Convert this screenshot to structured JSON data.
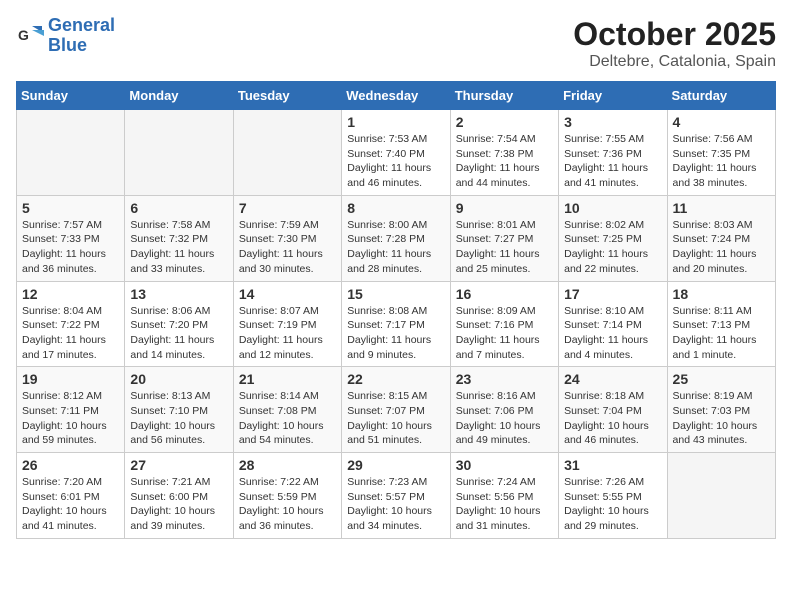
{
  "logo": {
    "line1": "General",
    "line2": "Blue"
  },
  "title": "October 2025",
  "location": "Deltebre, Catalonia, Spain",
  "days_of_week": [
    "Sunday",
    "Monday",
    "Tuesday",
    "Wednesday",
    "Thursday",
    "Friday",
    "Saturday"
  ],
  "weeks": [
    [
      {
        "day": "",
        "info": ""
      },
      {
        "day": "",
        "info": ""
      },
      {
        "day": "",
        "info": ""
      },
      {
        "day": "1",
        "info": "Sunrise: 7:53 AM\nSunset: 7:40 PM\nDaylight: 11 hours and 46 minutes."
      },
      {
        "day": "2",
        "info": "Sunrise: 7:54 AM\nSunset: 7:38 PM\nDaylight: 11 hours and 44 minutes."
      },
      {
        "day": "3",
        "info": "Sunrise: 7:55 AM\nSunset: 7:36 PM\nDaylight: 11 hours and 41 minutes."
      },
      {
        "day": "4",
        "info": "Sunrise: 7:56 AM\nSunset: 7:35 PM\nDaylight: 11 hours and 38 minutes."
      }
    ],
    [
      {
        "day": "5",
        "info": "Sunrise: 7:57 AM\nSunset: 7:33 PM\nDaylight: 11 hours and 36 minutes."
      },
      {
        "day": "6",
        "info": "Sunrise: 7:58 AM\nSunset: 7:32 PM\nDaylight: 11 hours and 33 minutes."
      },
      {
        "day": "7",
        "info": "Sunrise: 7:59 AM\nSunset: 7:30 PM\nDaylight: 11 hours and 30 minutes."
      },
      {
        "day": "8",
        "info": "Sunrise: 8:00 AM\nSunset: 7:28 PM\nDaylight: 11 hours and 28 minutes."
      },
      {
        "day": "9",
        "info": "Sunrise: 8:01 AM\nSunset: 7:27 PM\nDaylight: 11 hours and 25 minutes."
      },
      {
        "day": "10",
        "info": "Sunrise: 8:02 AM\nSunset: 7:25 PM\nDaylight: 11 hours and 22 minutes."
      },
      {
        "day": "11",
        "info": "Sunrise: 8:03 AM\nSunset: 7:24 PM\nDaylight: 11 hours and 20 minutes."
      }
    ],
    [
      {
        "day": "12",
        "info": "Sunrise: 8:04 AM\nSunset: 7:22 PM\nDaylight: 11 hours and 17 minutes."
      },
      {
        "day": "13",
        "info": "Sunrise: 8:06 AM\nSunset: 7:20 PM\nDaylight: 11 hours and 14 minutes."
      },
      {
        "day": "14",
        "info": "Sunrise: 8:07 AM\nSunset: 7:19 PM\nDaylight: 11 hours and 12 minutes."
      },
      {
        "day": "15",
        "info": "Sunrise: 8:08 AM\nSunset: 7:17 PM\nDaylight: 11 hours and 9 minutes."
      },
      {
        "day": "16",
        "info": "Sunrise: 8:09 AM\nSunset: 7:16 PM\nDaylight: 11 hours and 7 minutes."
      },
      {
        "day": "17",
        "info": "Sunrise: 8:10 AM\nSunset: 7:14 PM\nDaylight: 11 hours and 4 minutes."
      },
      {
        "day": "18",
        "info": "Sunrise: 8:11 AM\nSunset: 7:13 PM\nDaylight: 11 hours and 1 minute."
      }
    ],
    [
      {
        "day": "19",
        "info": "Sunrise: 8:12 AM\nSunset: 7:11 PM\nDaylight: 10 hours and 59 minutes."
      },
      {
        "day": "20",
        "info": "Sunrise: 8:13 AM\nSunset: 7:10 PM\nDaylight: 10 hours and 56 minutes."
      },
      {
        "day": "21",
        "info": "Sunrise: 8:14 AM\nSunset: 7:08 PM\nDaylight: 10 hours and 54 minutes."
      },
      {
        "day": "22",
        "info": "Sunrise: 8:15 AM\nSunset: 7:07 PM\nDaylight: 10 hours and 51 minutes."
      },
      {
        "day": "23",
        "info": "Sunrise: 8:16 AM\nSunset: 7:06 PM\nDaylight: 10 hours and 49 minutes."
      },
      {
        "day": "24",
        "info": "Sunrise: 8:18 AM\nSunset: 7:04 PM\nDaylight: 10 hours and 46 minutes."
      },
      {
        "day": "25",
        "info": "Sunrise: 8:19 AM\nSunset: 7:03 PM\nDaylight: 10 hours and 43 minutes."
      }
    ],
    [
      {
        "day": "26",
        "info": "Sunrise: 7:20 AM\nSunset: 6:01 PM\nDaylight: 10 hours and 41 minutes."
      },
      {
        "day": "27",
        "info": "Sunrise: 7:21 AM\nSunset: 6:00 PM\nDaylight: 10 hours and 39 minutes."
      },
      {
        "day": "28",
        "info": "Sunrise: 7:22 AM\nSunset: 5:59 PM\nDaylight: 10 hours and 36 minutes."
      },
      {
        "day": "29",
        "info": "Sunrise: 7:23 AM\nSunset: 5:57 PM\nDaylight: 10 hours and 34 minutes."
      },
      {
        "day": "30",
        "info": "Sunrise: 7:24 AM\nSunset: 5:56 PM\nDaylight: 10 hours and 31 minutes."
      },
      {
        "day": "31",
        "info": "Sunrise: 7:26 AM\nSunset: 5:55 PM\nDaylight: 10 hours and 29 minutes."
      },
      {
        "day": "",
        "info": ""
      }
    ]
  ]
}
